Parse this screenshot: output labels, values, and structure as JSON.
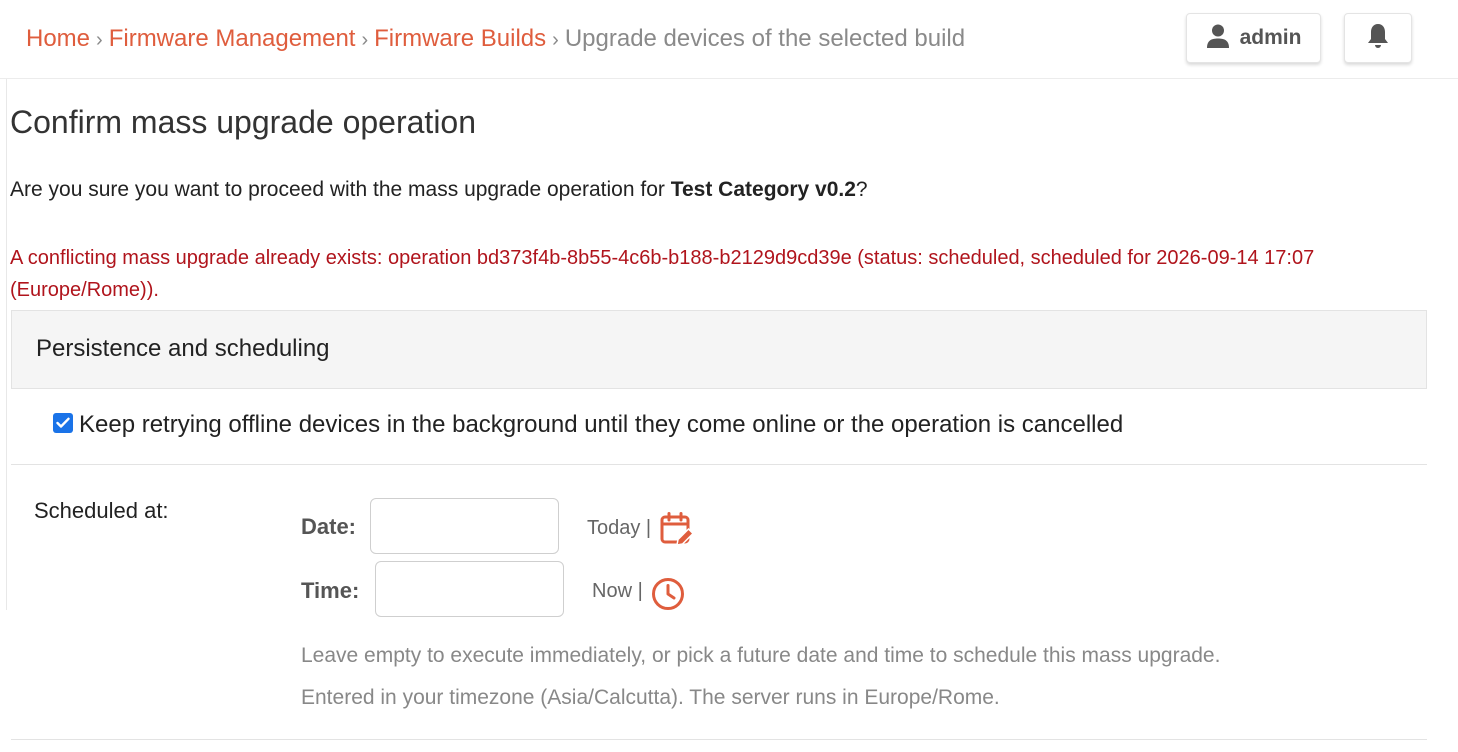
{
  "breadcrumb": {
    "items": [
      {
        "label": "Home"
      },
      {
        "label": "Firmware Management"
      },
      {
        "label": "Firmware Builds"
      }
    ],
    "current": "Upgrade devices of the selected build",
    "separator": "›"
  },
  "header": {
    "user_label": "admin",
    "user_icon": "person-icon",
    "bell_icon": "bell-icon"
  },
  "main": {
    "title": "Confirm mass upgrade operation",
    "confirm_prefix": "Are you sure you want to proceed with the mass upgrade operation for ",
    "build_name": "Test Category v0.2",
    "confirm_suffix": "?",
    "warning": "A conflicting mass upgrade already exists: operation bd373f4b-8b55-4c6b-b188-b2129d9cd39e (status: scheduled, scheduled for 2026-09-14 17:07 (Europe/Rome))."
  },
  "persistence": {
    "section_title": "Persistence and scheduling",
    "retry_label": "Keep retrying offline devices in the background until they come online or the operation is cancelled",
    "retry_checked": true
  },
  "schedule": {
    "label": "Scheduled at:",
    "date_label": "Date:",
    "date_value": "",
    "date_shortcut": "Today |",
    "date_icon": "calendar-edit-icon",
    "time_label": "Time:",
    "time_value": "",
    "time_shortcut": "Now |",
    "time_icon": "clock-icon",
    "help_1": "Leave empty to execute immediately, or pick a future date and time to schedule this mass upgrade.",
    "help_2": "Entered in your timezone (Asia/Calcutta). The server runs in Europe/Rome."
  },
  "colors": {
    "accent": "#df5d3d",
    "warning": "#b0141c",
    "checkbox": "#1a73e8"
  }
}
